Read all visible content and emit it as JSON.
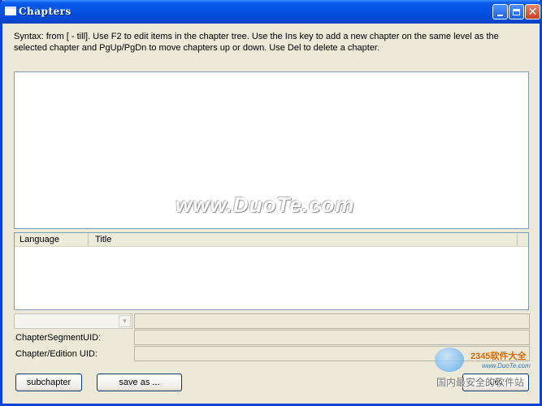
{
  "window": {
    "title": "Chapters"
  },
  "syntax_text": "Syntax:  from [ - till]. Use F2 to edit items in the chapter tree. Use the Ins key to add a new chapter on the same level as the selected chapter and PgUp/PgDn to move chapters up or down. Use Del to delete a chapter.",
  "watermark_text": "www.DuoTe.com",
  "language_list": {
    "columns": [
      "Language",
      "Title"
    ]
  },
  "fields": {
    "segment_uid_label": "ChapterSegmentUID:",
    "edition_uid_label": "Chapter/Edition UID:"
  },
  "buttons": {
    "subchapter": "subchapter",
    "save_as": "save as ...",
    "ok": "OK"
  },
  "site_logo": {
    "brand": "2345软件大全",
    "url": "www.DuoTe.com",
    "slogan": "国内最安全的软件站"
  },
  "colors": {
    "titlebar": "#0551e0",
    "window_bg": "#ece9d8",
    "border": "#7f9db9"
  }
}
